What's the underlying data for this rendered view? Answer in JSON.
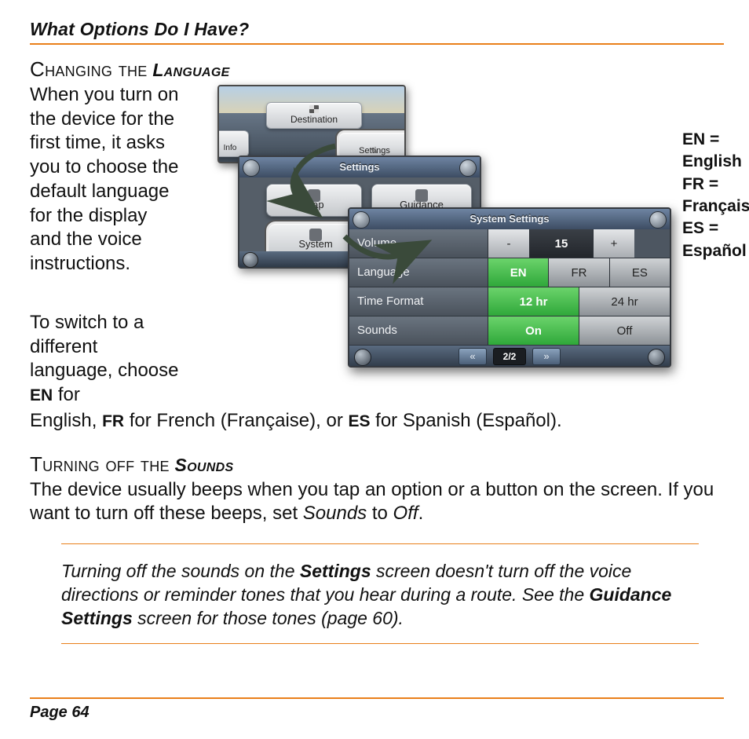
{
  "header": {
    "title": "What Options Do I Have?"
  },
  "section1": {
    "heading_pre": "Changing the",
    "heading_emph": "Language",
    "para1": "When you turn on the device for the first time, it asks you to choose the default language for the display and the voice instructions.",
    "para2_pre": "To switch to a different language, choose ",
    "para2_en": "EN",
    "para2_mid1": " for English, ",
    "para2_fr": "FR",
    "para2_mid2": " for French (Française), or ",
    "para2_es": "ES",
    "para2_end": " for Spanish (Español)."
  },
  "shots": {
    "shot1": {
      "destination": "Destination",
      "info": "Info",
      "settings": "Settings"
    },
    "shot2": {
      "title": "Settings",
      "map": "Map",
      "guidance": "Guidance",
      "system": "System"
    },
    "shot3": {
      "title": "System Settings",
      "rows": {
        "volume": {
          "label": "Volume",
          "minus": "-",
          "value": "15",
          "plus": "+"
        },
        "language": {
          "label": "Language",
          "en": "EN",
          "fr": "FR",
          "es": "ES"
        },
        "timeformat": {
          "label": "Time Format",
          "h12": "12 hr",
          "h24": "24 hr"
        },
        "sounds": {
          "label": "Sounds",
          "on": "On",
          "off": "Off"
        }
      },
      "pager": {
        "prev": "«",
        "page": "2/2",
        "next": "»"
      }
    }
  },
  "legend": {
    "en": "EN = English",
    "fr": "FR = Française",
    "es": "ES = Español"
  },
  "section2": {
    "heading_pre": "Turning off the",
    "heading_emph": "Sounds",
    "para_pre": "The device usually beeps when you tap an option or a button on the screen. If you want to turn off these beeps, set ",
    "para_sounds": "Sounds",
    "para_mid": " to ",
    "para_off": "Off",
    "para_end": "."
  },
  "note": {
    "t1": "Turning off the sounds on the ",
    "b1": "Settings",
    "t2": " screen doesn't turn off the voice directions or reminder tones that you hear during a route. See the ",
    "b2": "Guidance Settings",
    "t3": " screen for those tones (page 60)."
  },
  "footer": {
    "page": "Page 64"
  }
}
